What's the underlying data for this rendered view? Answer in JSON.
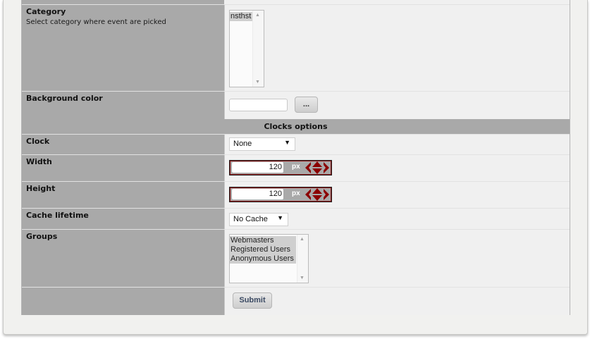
{
  "category": {
    "label": "Category",
    "description": "Select category where event are picked",
    "options": [
      "nsthst"
    ]
  },
  "background_color": {
    "label": "Background color",
    "value": "",
    "picker_button": "..."
  },
  "clocks_section": {
    "title": "Clocks options"
  },
  "clock": {
    "label": "Clock",
    "selected": "None"
  },
  "width": {
    "label": "Width",
    "value": "120",
    "unit": "px"
  },
  "height": {
    "label": "Height",
    "value": "120",
    "unit": "px"
  },
  "cache_lifetime": {
    "label": "Cache lifetime",
    "selected": "No Cache"
  },
  "groups": {
    "label": "Groups",
    "options": [
      "Webmasters",
      "Registered Users",
      "Anonymous Users"
    ]
  },
  "submit": {
    "label": "Submit"
  },
  "colors": {
    "label_bg": "#a9a9a9",
    "value_bg": "#f0f0f0",
    "spinner_red": "#8b0000"
  }
}
